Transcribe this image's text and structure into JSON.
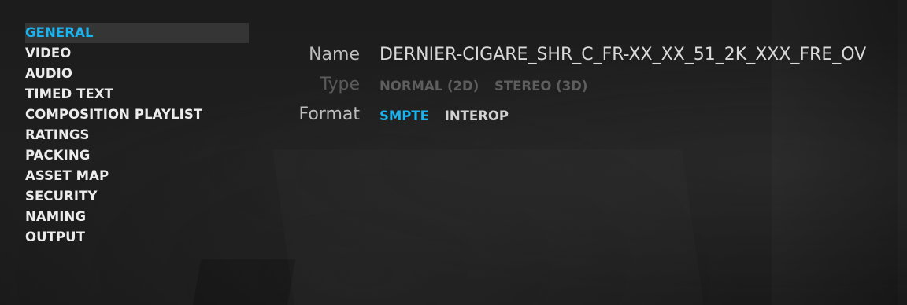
{
  "sidebar": {
    "items": [
      {
        "label": "GENERAL",
        "active": true
      },
      {
        "label": "VIDEO",
        "active": false
      },
      {
        "label": "AUDIO",
        "active": false
      },
      {
        "label": "TIMED TEXT",
        "active": false
      },
      {
        "label": "COMPOSITION PLAYLIST",
        "active": false
      },
      {
        "label": "RATINGS",
        "active": false
      },
      {
        "label": "PACKING",
        "active": false
      },
      {
        "label": "ASSET MAP",
        "active": false
      },
      {
        "label": "SECURITY",
        "active": false
      },
      {
        "label": "NAMING",
        "active": false
      },
      {
        "label": "OUTPUT",
        "active": false
      }
    ]
  },
  "general": {
    "name": {
      "label": "Name",
      "value": "DERNIER-CIGARE_SHR_C_FR-XX_XX_51_2K_XXX_FRE_OV"
    },
    "type": {
      "label": "Type",
      "options": [
        "NORMAL (2D)",
        "STEREO (3D)"
      ],
      "disabled": true
    },
    "format": {
      "label": "Format",
      "options": [
        "SMPTE",
        "INTEROP"
      ],
      "selected": "SMPTE"
    }
  },
  "colors": {
    "accent": "#1ab3ee",
    "background": "#1c1c1c",
    "active_item_bg": "#353535"
  }
}
